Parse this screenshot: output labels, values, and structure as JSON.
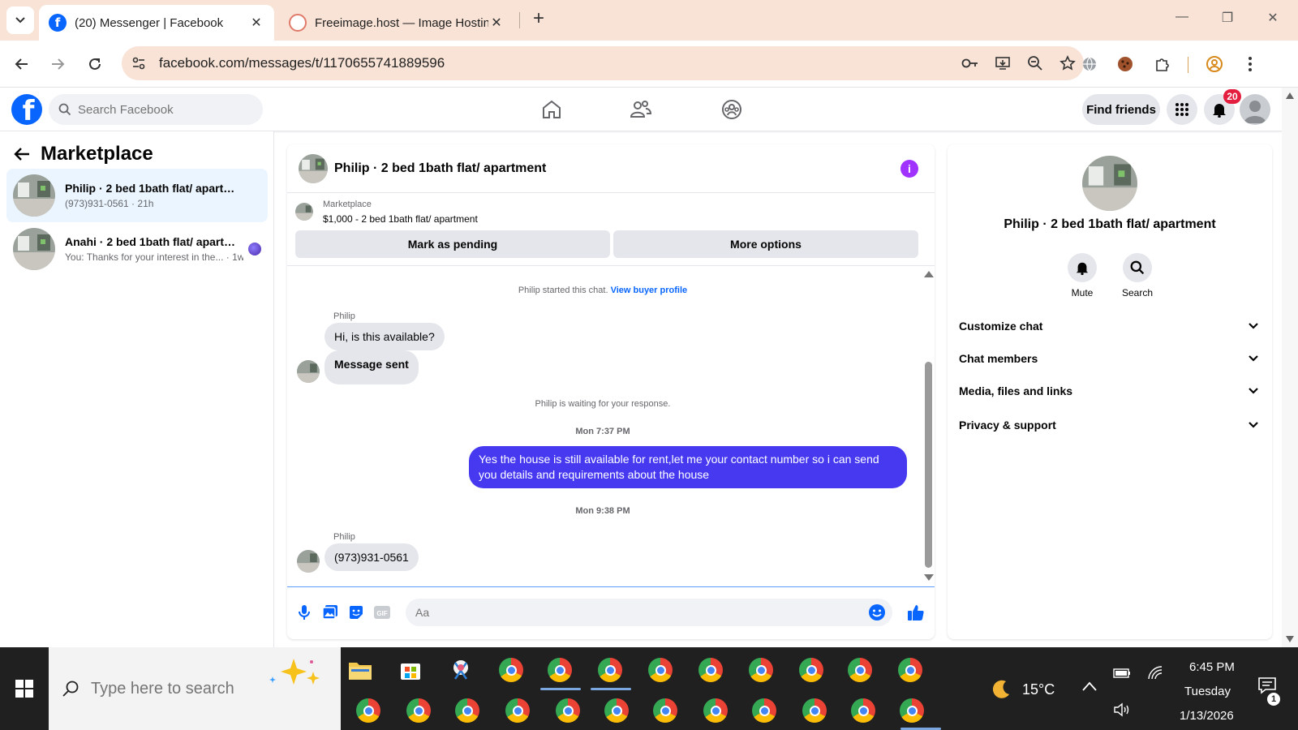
{
  "browser": {
    "tabs": [
      {
        "label": "(20) Messenger | Facebook",
        "active": true
      },
      {
        "label": "Freeimage.host — Image Hostin",
        "active": false
      }
    ],
    "url": "facebook.com/messages/t/1170655741889596",
    "accent": "#f8e3d6"
  },
  "fb": {
    "search_placeholder": "Search Facebook",
    "find_friends": "Find friends",
    "notification_count": "20",
    "brand_color": "#0866ff"
  },
  "left": {
    "title": "Marketplace",
    "conversations": [
      {
        "name": "Philip · 2 bed 1bath flat/ apartment",
        "preview": "(973)931-0561 · 21h",
        "selected": true
      },
      {
        "name": "Anahi · 2 bed 1bath flat/ apartm...",
        "preview": "You: Thanks for your interest in the... · 1w",
        "selected": false
      }
    ]
  },
  "chat": {
    "title": "Philip · 2 bed 1bath flat/ apartment",
    "marketplace_label": "Marketplace",
    "listing": "$1,000 - 2 bed 1bath flat/ apartment",
    "mark_pending": "Mark as pending",
    "more_options": "More options",
    "started_text": "Philip started this chat.",
    "view_buyer": "View buyer profile",
    "sender1": "Philip",
    "msg1": "Hi, is this available?",
    "msg2": "Message sent",
    "waiting": "Philip is waiting for your response.",
    "time1": "Mon 7:37 PM",
    "outgoing": "Yes the house is still available for rent,let me your contact number so i can send you details and requirements about the house",
    "time2": "Mon 9:38 PM",
    "sender2": "Philip",
    "msg3": "(973)931-0561",
    "composer_placeholder": "Aa",
    "outgoing_color": "#4639f0"
  },
  "info": {
    "name": "Philip · 2 bed 1bath flat/ apartment",
    "actions": [
      "Mute",
      "Search"
    ],
    "sections": [
      "Customize chat",
      "Chat members",
      "Media, files and links",
      "Privacy & support"
    ]
  },
  "taskbar": {
    "search_placeholder": "Type here to search",
    "temperature": "15°C",
    "time": "6:45 PM",
    "day": "Tuesday",
    "date": "1/13/2026",
    "notification_badge": "1"
  }
}
